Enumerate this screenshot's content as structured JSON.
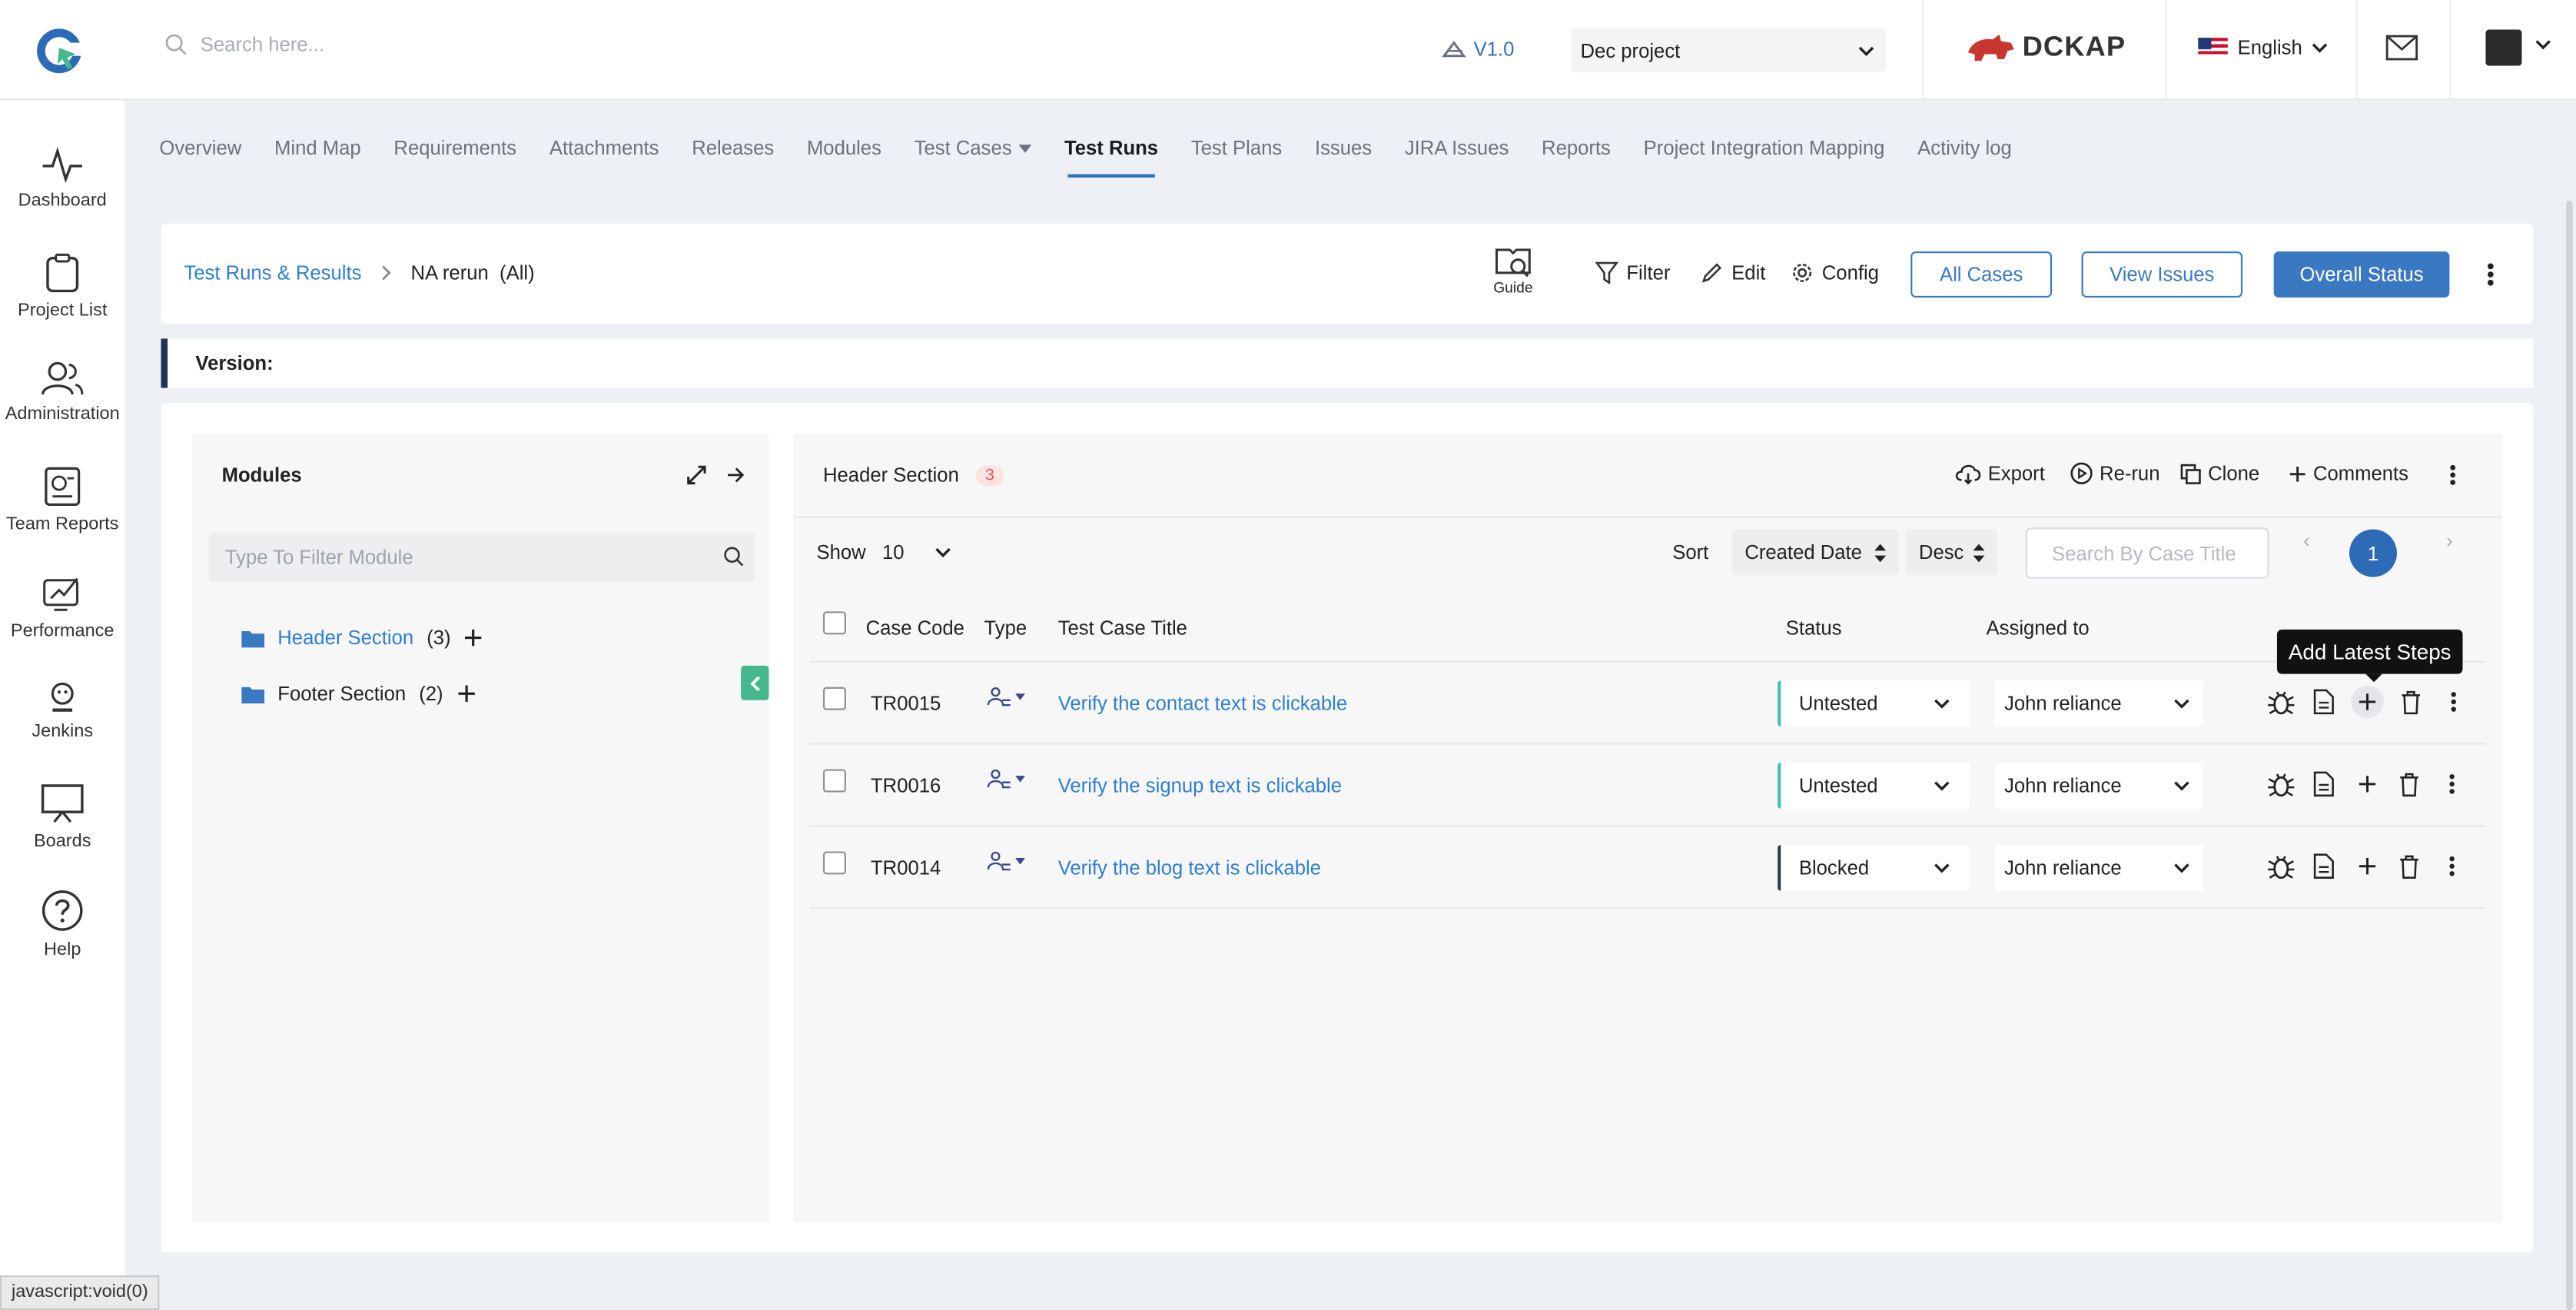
{
  "topbar": {
    "search_placeholder": "Search here...",
    "version": "V1.0",
    "project": "Dec project",
    "brand": "DCKAP",
    "language": "English"
  },
  "sidebar": {
    "items": [
      {
        "label": "Dashboard",
        "icon": "pulse-icon"
      },
      {
        "label": "Project List",
        "icon": "clipboard-icon"
      },
      {
        "label": "Administration",
        "icon": "users-icon"
      },
      {
        "label": "Team Reports",
        "icon": "report-icon"
      },
      {
        "label": "Performance",
        "icon": "performance-icon"
      },
      {
        "label": "Jenkins",
        "icon": "jenkins-icon"
      },
      {
        "label": "Boards",
        "icon": "board-icon"
      },
      {
        "label": "Help",
        "icon": "help-icon"
      }
    ]
  },
  "tabs": [
    {
      "label": "Overview"
    },
    {
      "label": "Mind Map"
    },
    {
      "label": "Requirements"
    },
    {
      "label": "Attachments"
    },
    {
      "label": "Releases"
    },
    {
      "label": "Modules"
    },
    {
      "label": "Test Cases"
    },
    {
      "label": "Test Runs",
      "active": true
    },
    {
      "label": "Test Plans"
    },
    {
      "label": "Issues"
    },
    {
      "label": "JIRA Issues"
    },
    {
      "label": "Reports"
    },
    {
      "label": "Project Integration Mapping"
    },
    {
      "label": "Activity log"
    }
  ],
  "header": {
    "breadcrumb_link": "Test Runs & Results",
    "breadcrumb_current": "NA rerun",
    "breadcrumb_scope": "(All)",
    "guide": "Guide",
    "filter": "Filter",
    "edit": "Edit",
    "config": "Config",
    "all_cases": "All Cases",
    "view_issues": "View Issues",
    "overall_status": "Overall Status"
  },
  "version_bar": {
    "label": "Version:"
  },
  "modules": {
    "title": "Modules",
    "filter_placeholder": "Type To Filter Module",
    "items": [
      {
        "name": "Header Section",
        "count": "(3)"
      },
      {
        "name": "Footer Section",
        "count": "(2)"
      }
    ]
  },
  "table": {
    "section_title": "Header Section",
    "section_count": "3",
    "actions": {
      "export": "Export",
      "rerun": "Re-run",
      "clone": "Clone",
      "comments": "Comments"
    },
    "show_label": "Show",
    "show_value": "10",
    "sort_label": "Sort",
    "sort_field": "Created Date",
    "sort_order": "Desc",
    "search_placeholder": "Search By Case Title",
    "page": "1",
    "prev": "‹",
    "next": "›",
    "columns": {
      "code": "Case Code",
      "type": "Type",
      "title": "Test Case Title",
      "status": "Status",
      "assigned": "Assigned to"
    },
    "rows": [
      {
        "code": "TR0015",
        "title": "Verify the contact text is clickable",
        "status": "Untested",
        "assigned": "John reliance"
      },
      {
        "code": "TR0016",
        "title": "Verify the signup text is clickable",
        "status": "Untested",
        "assigned": "John reliance"
      },
      {
        "code": "TR0014",
        "title": "Verify the blog text is clickable",
        "status": "Blocked",
        "assigned": "John reliance"
      }
    ],
    "tooltip": "Add Latest Steps"
  },
  "statusbar": {
    "text": "javascript:void(0)"
  },
  "colors": {
    "accent": "#3a78c2",
    "link": "#2f7fd1",
    "untested": "#3fbfb2",
    "blocked": "#2d3a48",
    "handle": "#45b98c"
  }
}
